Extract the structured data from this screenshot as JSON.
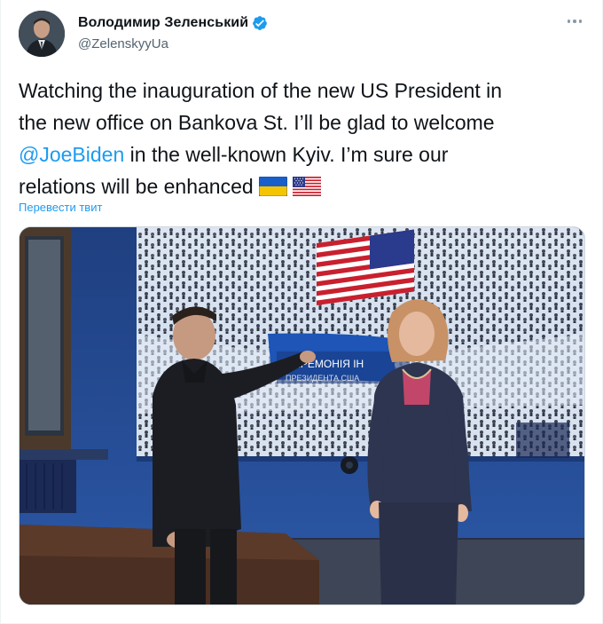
{
  "author": {
    "display_name": "Володимир Зеленський",
    "handle": "@ZelenskyyUa",
    "verified": true
  },
  "tweet": {
    "line1": "Watching the inauguration of the new US President in",
    "line2": "the new office on Bankova St. I’ll be glad to welcome",
    "mention": "@JoeBiden",
    "line3_rest": " in the well-known Kyiv. I’m sure our",
    "line4": "relations will be enhanced",
    "emojis": [
      "ukraine-flag",
      "us-flag"
    ]
  },
  "translate_label": "Перевести твит",
  "photo": {
    "screen_text_line1": "ЦЕРЕМОНІЯ ІН",
    "screen_text_line2": "ПРЕЗИДЕНТА США"
  },
  "colors": {
    "link": "#1d9bf0",
    "text": "#0f1419",
    "secondary": "#536471",
    "verified": "#1d9bf0"
  }
}
